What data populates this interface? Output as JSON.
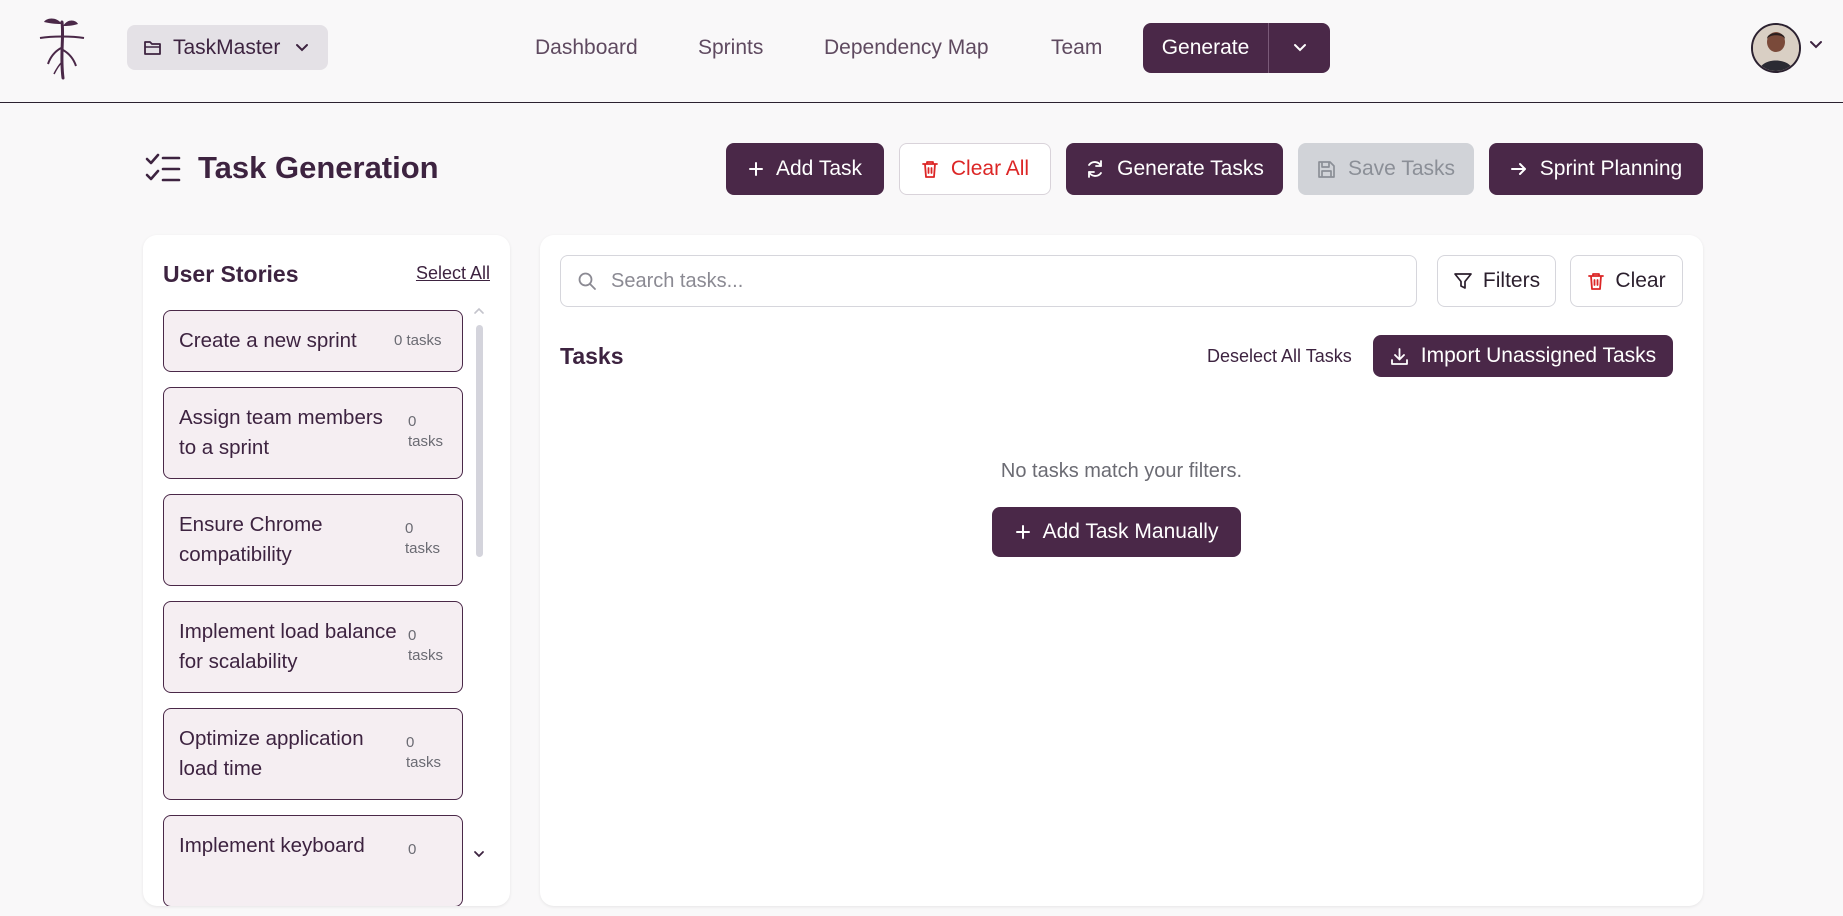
{
  "colors": {
    "brand": "#4a2848",
    "danger": "#dc2626",
    "story_bg": "#f5eef2"
  },
  "header": {
    "project": {
      "name": "TaskMaster",
      "icon": "folder-icon"
    },
    "nav": [
      "Dashboard",
      "Sprints",
      "Dependency Map",
      "Team"
    ],
    "generate_label": "Generate"
  },
  "page": {
    "title": "Task Generation",
    "actions": {
      "add_task": "Add Task",
      "clear_all": "Clear All",
      "generate_tasks": "Generate Tasks",
      "save_tasks": "Save Tasks",
      "sprint_planning": "Sprint Planning"
    }
  },
  "stories_panel": {
    "title": "User Stories",
    "select_all": "Select All",
    "stories": [
      {
        "lines": [
          "Create a new sprint"
        ],
        "count_lines": [
          "0 tasks"
        ]
      },
      {
        "lines": [
          "Assign team members",
          "to a sprint"
        ],
        "count_lines": [
          "0",
          "tasks"
        ]
      },
      {
        "lines": [
          "Ensure Chrome",
          "compatibility"
        ],
        "count_lines": [
          "0",
          "tasks"
        ]
      },
      {
        "lines": [
          "Implement load balance",
          "for scalability"
        ],
        "count_lines": [
          "0",
          "tasks"
        ]
      },
      {
        "lines": [
          "Optimize application",
          "load time"
        ],
        "count_lines": [
          "0",
          "tasks"
        ]
      },
      {
        "lines": [
          "Implement keyboard"
        ],
        "count_lines": [
          "0"
        ]
      }
    ]
  },
  "tasks_panel": {
    "search_placeholder": "Search tasks...",
    "filters": "Filters",
    "clear": "Clear",
    "title": "Tasks",
    "deselect_all": "Deselect All Tasks",
    "import": "Import Unassigned Tasks",
    "empty_message": "No tasks match your filters.",
    "add_manually": "Add Task Manually"
  }
}
